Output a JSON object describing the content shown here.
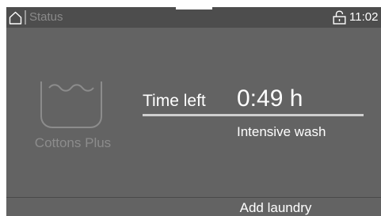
{
  "header": {
    "title": "Status",
    "time": "11:02",
    "icons": {
      "home": "home-icon",
      "lock": "unlocked-padlock-icon"
    }
  },
  "program": {
    "name": "Cottons Plus",
    "icon": "washing-tub-icon"
  },
  "timer": {
    "label": "Time left",
    "value": "0:49 h",
    "mode": "Intensive wash"
  },
  "actions": {
    "add_laundry": "Add laundry"
  },
  "colors": {
    "screen_bg": "#636363",
    "topbar_bg": "#4d4d4d",
    "text": "#ffffff",
    "dim_text": "#8c8c8c"
  }
}
